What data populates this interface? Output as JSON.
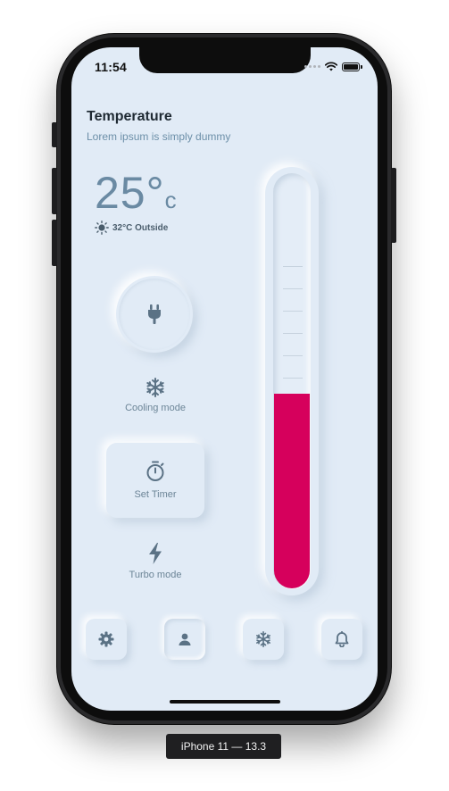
{
  "status_bar": {
    "time": "11:54"
  },
  "header": {
    "title": "Temperature",
    "subtitle": "Lorem ipsum is simply dummy"
  },
  "temperature": {
    "value": "25°",
    "unit": "c",
    "outside": "32°C Outside"
  },
  "thermometer": {
    "level_fraction": 0.47,
    "fill_color": "#d6005c"
  },
  "controls": {
    "power_icon": "plug-icon",
    "cooling": {
      "label": "Cooling mode",
      "icon": "snowflake-icon"
    },
    "timer": {
      "label": "Set Timer",
      "icon": "stopwatch-icon"
    },
    "turbo": {
      "label": "Turbo mode",
      "icon": "lightning-icon"
    }
  },
  "bottom_nav": {
    "items": [
      {
        "icon": "gear-icon",
        "active": false
      },
      {
        "icon": "user-icon",
        "active": true
      },
      {
        "icon": "snowflake-icon",
        "active": false
      },
      {
        "icon": "bell-icon",
        "active": false
      }
    ]
  },
  "device_caption": "iPhone 11 — 13.3",
  "colors": {
    "background": "#e1ebf6",
    "accent": "#d6005c",
    "icon": "#5b7285"
  }
}
